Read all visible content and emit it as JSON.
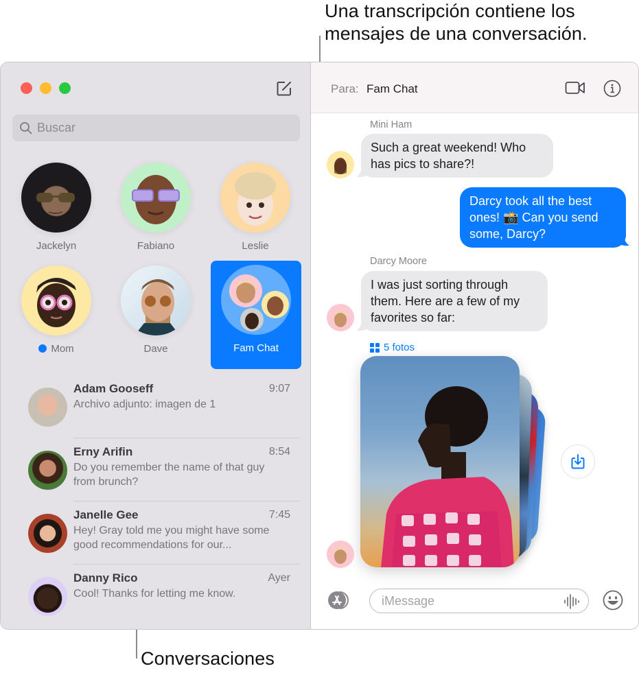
{
  "callouts": {
    "transcript": [
      "Una transcripción contiene los",
      "mensajes de una conversación."
    ],
    "conversations": "Conversaciones"
  },
  "window": {
    "controls": [
      "close",
      "minimize",
      "maximize"
    ],
    "compose_icon": "compose-icon"
  },
  "sidebar": {
    "search": {
      "placeholder": "Buscar",
      "value": "",
      "icon": "search-icon"
    },
    "pinned": [
      {
        "name": "Jackelyn",
        "unread": false,
        "selected": false,
        "avatar_bg": "#2b2b2b"
      },
      {
        "name": "Fabiano",
        "unread": false,
        "selected": false,
        "avatar_bg": "#bff0c8"
      },
      {
        "name": "Leslie",
        "unread": false,
        "selected": false,
        "avatar_bg": "#fdd9a3"
      },
      {
        "name": "Mom",
        "unread": true,
        "selected": false,
        "avatar_bg": "#fde9a3"
      },
      {
        "name": "Dave",
        "unread": false,
        "selected": false,
        "avatar_bg": "#d8e6ef"
      },
      {
        "name": "Fam Chat",
        "unread": false,
        "selected": true,
        "avatar_bg": "#63aefc"
      }
    ],
    "conversations": [
      {
        "name": "Adam Gooseff",
        "time": "9:07",
        "preview": "Archivo adjunto: imagen de 1"
      },
      {
        "name": "Erny Arifin",
        "time": "8:54",
        "preview": "Do you remember the name of that guy from brunch?"
      },
      {
        "name": "Janelle Gee",
        "time": "7:45",
        "preview": "Hey! Gray told me you might have some good recommendations for our..."
      },
      {
        "name": "Danny Rico",
        "time": "Ayer",
        "preview": "Cool! Thanks for letting me know."
      }
    ]
  },
  "chat": {
    "header": {
      "to_label": "Para:",
      "to_value": "Fam Chat",
      "video_icon": "video-camera-icon",
      "info_icon": "info-icon"
    },
    "messages": [
      {
        "sender": "Mini Ham",
        "direction": "in",
        "text": [
          "Such a great weekend! Who",
          "has pics to share?!"
        ]
      },
      {
        "sender": "",
        "direction": "out",
        "text": [
          "Darcy took all the best",
          "ones! 📸 Can you send",
          "some, Darcy?"
        ]
      },
      {
        "sender": "Darcy Moore",
        "direction": "in",
        "text": [
          "I was just sorting through",
          "them. Here are a few of my",
          "favorites so far:"
        ]
      }
    ],
    "photos": {
      "label": "5 fotos",
      "count": 5
    },
    "composer": {
      "placeholder": "iMessage",
      "value": ""
    },
    "colors": {
      "accent": "#0a7aff",
      "incoming_bubble": "#e9e9eb"
    }
  }
}
